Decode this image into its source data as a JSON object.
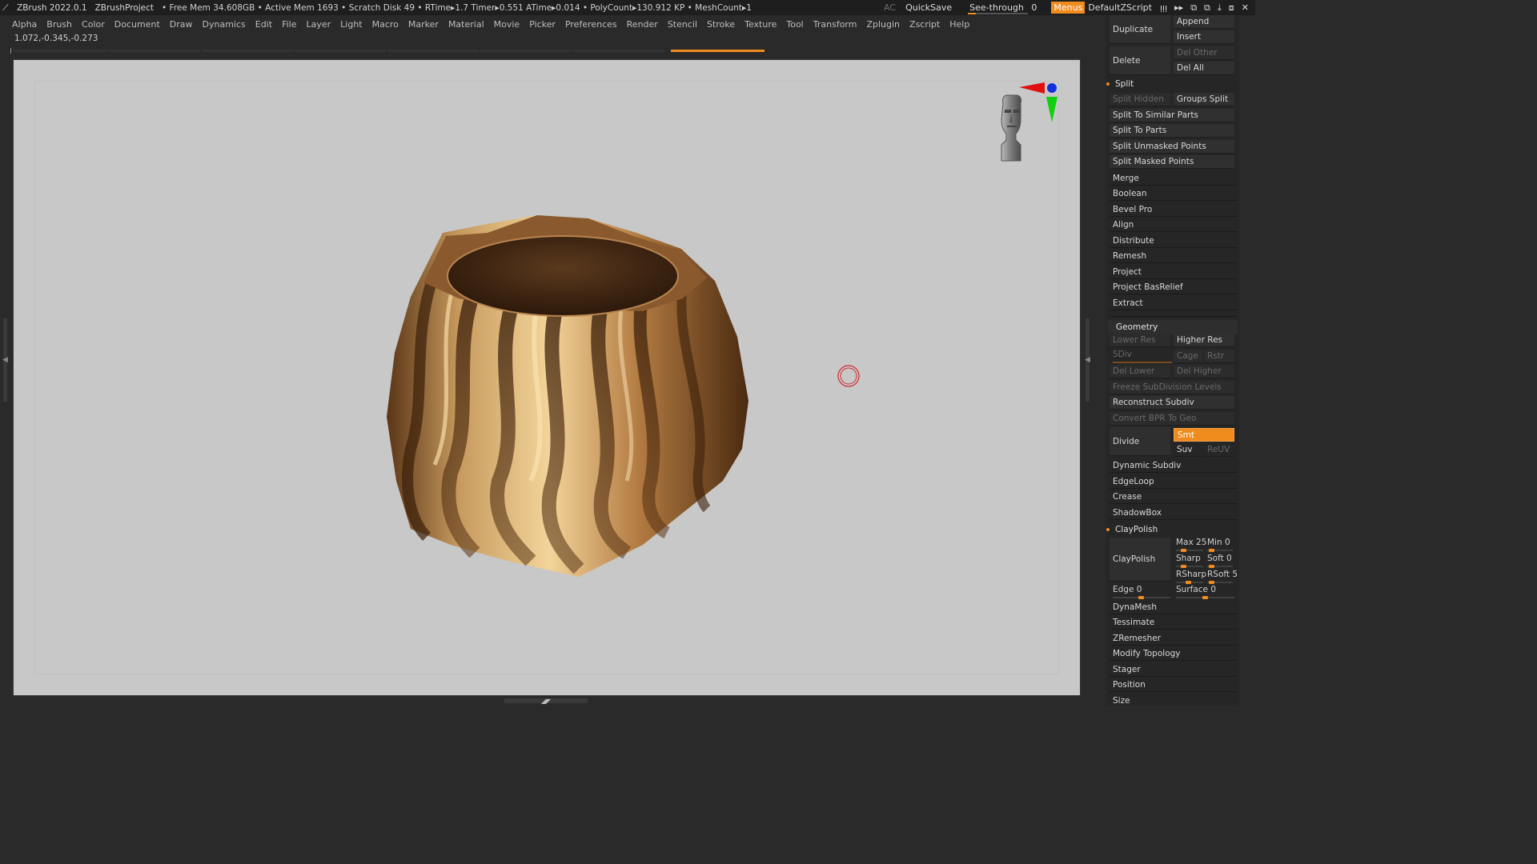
{
  "titlebar": {
    "app": "ZBrush 2022.0.1",
    "project": "ZBrushProject",
    "stats": "• Free Mem 34.608GB • Active Mem 1693 • Scratch Disk 49 •  RTime▸1.7 Timer▸0.551 ATime▸0.014 • PolyCount▸130.912 KP  • MeshCount▸1",
    "ac": "AC",
    "quicksave": "QuickSave",
    "seethrough_label": "See-through",
    "seethrough_value": "0",
    "menus": "Menus",
    "script": "DefaultZScript"
  },
  "menubar": [
    "Alpha",
    "Brush",
    "Color",
    "Document",
    "Draw",
    "Dynamics",
    "Edit",
    "File",
    "Layer",
    "Light",
    "Macro",
    "Marker",
    "Material",
    "Movie",
    "Picker",
    "Preferences",
    "Render",
    "Stencil",
    "Stroke",
    "Texture",
    "Tool",
    "Transform",
    "Zplugin",
    "Zscript",
    "Help"
  ],
  "coords": "1.072,-0.345,-0.273",
  "panel": {
    "duplicate": "Duplicate",
    "append": "Append",
    "insert": "Insert",
    "delete": "Delete",
    "del_other": "Del Other",
    "del_all": "Del All",
    "split_header": "Split",
    "split_hidden": "Split Hidden",
    "groups_split": "Groups Split",
    "split_similar": "Split To Similar Parts",
    "split_parts": "Split To Parts",
    "split_unmasked": "Split Unmasked Points",
    "split_masked": "Split Masked Points",
    "merge": "Merge",
    "boolean": "Boolean",
    "bevel_pro": "Bevel Pro",
    "align": "Align",
    "distribute": "Distribute",
    "remesh": "Remesh",
    "project": "Project",
    "project_basrelief": "Project BasRelief",
    "extract": "Extract",
    "geometry_header": "Geometry",
    "lower_res": "Lower Res",
    "higher_res": "Higher Res",
    "sdiv": "SDiv",
    "cage": "Cage",
    "rstr": "Rstr",
    "del_lower": "Del Lower",
    "del_higher": "Del Higher",
    "freeze_subdiv": "Freeze SubDivision Levels",
    "reconstruct_subdiv": "Reconstruct Subdiv",
    "convert_bpr": "Convert BPR To Geo",
    "divide": "Divide",
    "smt": "Smt",
    "suv": "Suv",
    "reuv": "ReUV",
    "dynamic_subdiv": "Dynamic Subdiv",
    "edgeloop": "EdgeLoop",
    "crease": "Crease",
    "shadowbox": "ShadowBox",
    "claypolish_header": "ClayPolish",
    "claypolish": "ClayPolish",
    "max": "Max 25",
    "min": "Min 0",
    "sharp": "Sharp",
    "soft": "Soft 0",
    "rsharp": "RSharp",
    "rsoft": "RSoft 5",
    "edge": "Edge 0",
    "surface": "Surface 0",
    "dynamesh": "DynaMesh",
    "tessimate": "Tessimate",
    "zremesher": "ZRemesher",
    "modify_topology": "Modify Topology",
    "stager": "Stager",
    "position": "Position",
    "size": "Size"
  },
  "colors": {
    "accent": "#f08b1d",
    "canvas_bg": "#c8c8c8",
    "ui_bg": "#2a2a2a"
  }
}
